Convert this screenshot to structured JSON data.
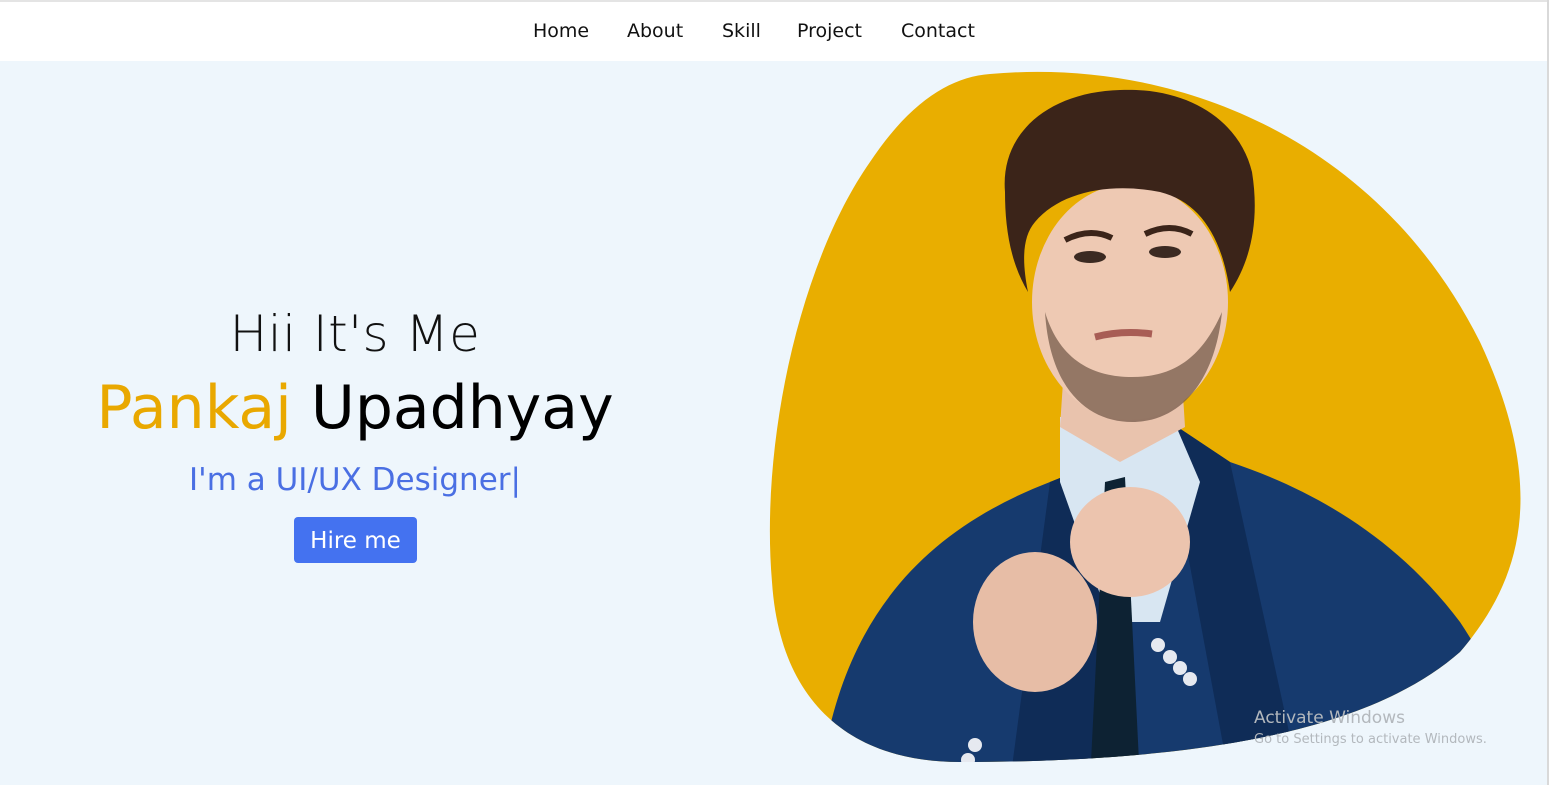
{
  "nav": {
    "items": [
      "Home",
      "About",
      "Skill",
      "Project",
      "Contact"
    ]
  },
  "hero": {
    "greeting": "Hii It's Me",
    "first_name": "Pankaj",
    "last_name": "Upadhyay",
    "role": "I'm a UI/UX Designer|",
    "cta_label": "Hire me"
  },
  "watermark": {
    "title": "Activate Windows",
    "subtitle": "Go to Settings to activate Windows."
  },
  "colors": {
    "accent": "#e9a800",
    "button": "#4472f0",
    "role_text": "#4a6fe3",
    "background": "#eef6fc",
    "blob": "#e9ae00",
    "jacket": "#163a6e"
  },
  "icons": [
    "portrait-photo"
  ]
}
